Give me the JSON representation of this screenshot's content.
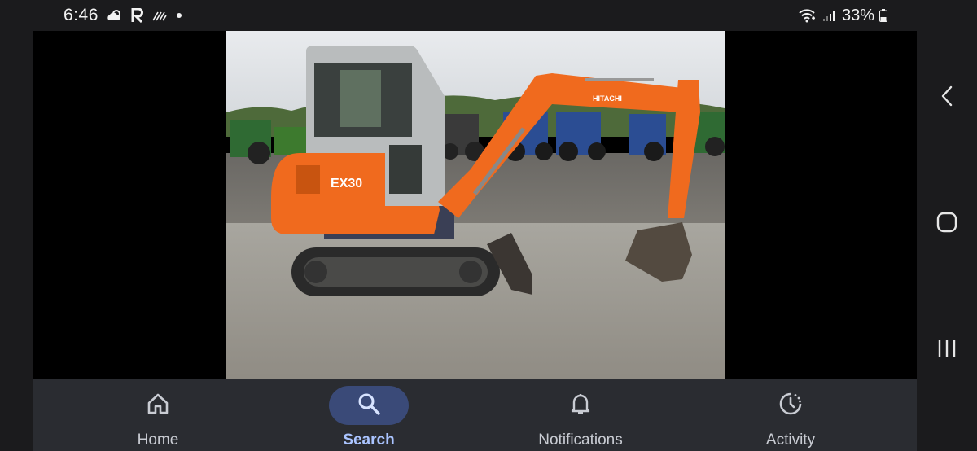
{
  "status_bar": {
    "time": "6:46",
    "battery": "33%",
    "left_icons": [
      "weather-cloud-icon",
      "r-app-icon",
      "signal-noise-icon",
      "dot-icon"
    ],
    "right_icons": [
      "wifi-calling-icon",
      "cell-signal-icon",
      "battery-icon"
    ]
  },
  "photo": {
    "model_label": "EX30",
    "brand_label": "HITACHI"
  },
  "bottom_nav": {
    "items": [
      {
        "label": "Home",
        "icon": "home-icon",
        "active": false
      },
      {
        "label": "Search",
        "icon": "search-icon",
        "active": true
      },
      {
        "label": "Notifications",
        "icon": "bell-icon",
        "active": false
      },
      {
        "label": "Activity",
        "icon": "activity-clock-icon",
        "active": false
      }
    ]
  },
  "system_nav": [
    "back-icon",
    "home-circle-icon",
    "recents-icon"
  ],
  "colors": {
    "nav_bg": "#2a2c31",
    "active_pill": "#3a4a78",
    "active_label": "#aac4ff",
    "excavator_orange": "#f06a1e"
  }
}
